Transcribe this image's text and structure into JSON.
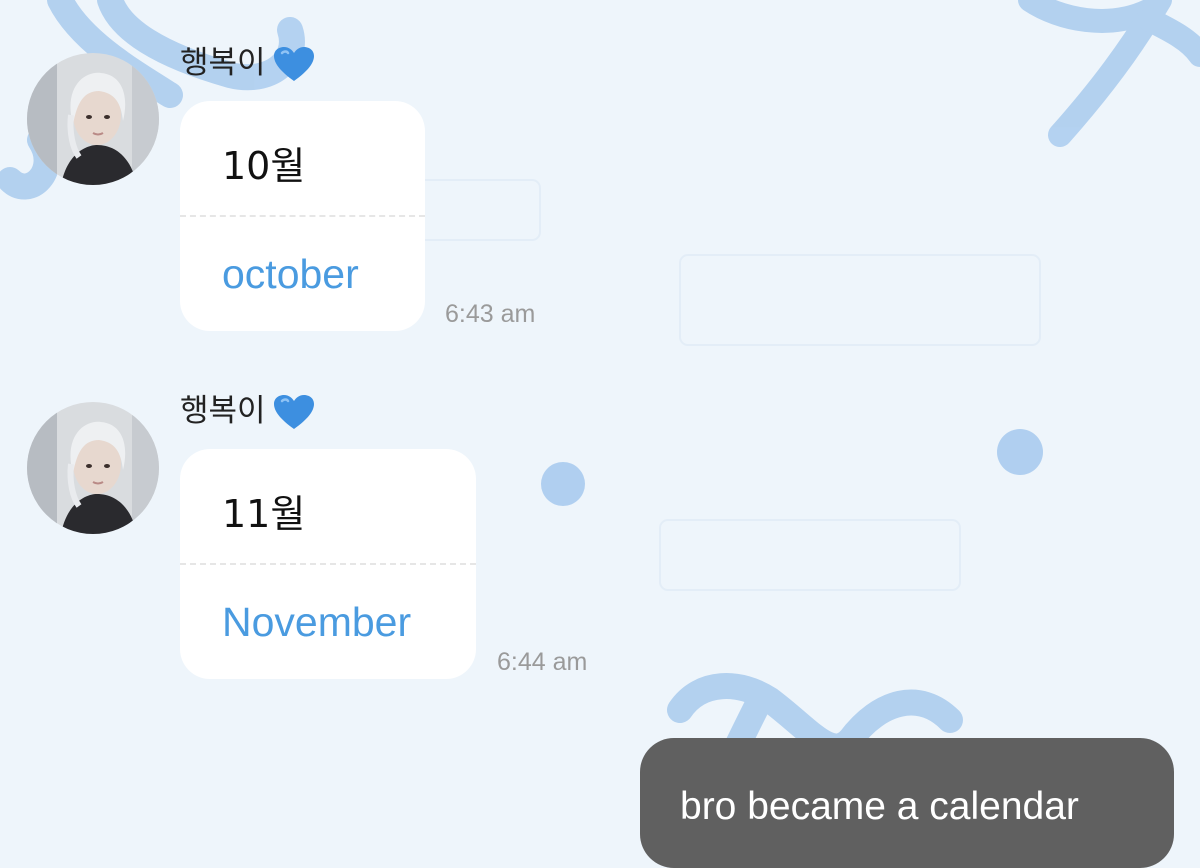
{
  "messages": [
    {
      "sender": "행복이",
      "month_ko": "10월",
      "month_en": "october",
      "time": "6:43 am"
    },
    {
      "sender": "행복이",
      "month_ko": "11월",
      "month_en": "November",
      "time": "6:44 am"
    }
  ],
  "outgoing": {
    "text": "bro became a calendar"
  },
  "icons": {
    "heart": "blue-heart-icon",
    "avatar": "profile-photo"
  },
  "colors": {
    "background": "#eef5fb",
    "ribbon": "#a9cbee",
    "link_blue": "#4a9be0",
    "timestamp": "#9a9a9a",
    "outgoing_bubble": "#606060"
  }
}
